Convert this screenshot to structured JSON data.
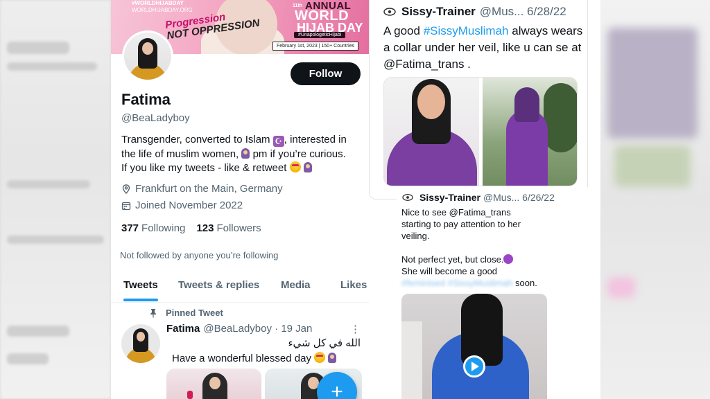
{
  "banner": {
    "tagline_1": "#WORLDHIJABDAY",
    "tagline_2": "WORLDHIJABDAY.ORG",
    "slogan_1": "Progression",
    "slogan_2": "NOT OPPRESSION",
    "event_small": "11th",
    "event_word_1": "ANNUAL",
    "event_word_2": "WORLD",
    "event_word_3": "HIJAB DAY",
    "hashtag": "#UnapologeticHijabi",
    "date": "February 1st, 2023 | 150+ Countries"
  },
  "profile": {
    "follow_label": "Follow",
    "display_name": "Fatima",
    "handle": "@BeaLadyboy",
    "bio_line_1": "Transgender, converted to Islam",
    "bio_line_1_end": ", interested in",
    "bio_line_2": "the life of muslim women,",
    "bio_line_2_end": "pm if you’re curious.",
    "bio_line_3": "If you like my tweets - like & retweet",
    "location": "Frankfurt on the Main, Germany",
    "joined": "Joined November 2022",
    "following_count": "377",
    "following_label": "Following",
    "followers_count": "123",
    "followers_label": "Followers",
    "not_followed": "Not followed by anyone you’re following"
  },
  "tabs": [
    "Tweets",
    "Tweets & replies",
    "Media",
    "Likes"
  ],
  "pinned": {
    "label": "Pinned Tweet",
    "name": "Fatima",
    "handle_date": "@BeaLadyboy · 19 Jan",
    "more": "⋮",
    "arabic": "الله في كل شيء",
    "text": "Have a wonderful blessed day"
  },
  "fab_label": "+",
  "tweet1": {
    "name": "Sissy-Trainer",
    "handle_date": "@Mus... 6/28/22",
    "text_1": "A good",
    "hashtag": "#SissyMuslimah",
    "text_2": "always wears a collar under her veil, like u can se at @Fatima_trans ."
  },
  "tweet2": {
    "name": "Sissy-Trainer",
    "handle_date": "@Mus... 6/26/22",
    "para_1": "Nice to see @Fatima_trans starting to pay attention to her veiling.",
    "para_2a": "Not perfect yet, but close.",
    "para_2b": "She will become a good",
    "blurred": "#feminised #SissyMuslimah",
    "para_2c": "soon."
  },
  "icons": {
    "location": "location-pin-icon",
    "calendar": "calendar-icon",
    "pin": "pin-icon",
    "play": "play-icon",
    "plus": "plus-icon"
  },
  "colors": {
    "accent": "#1d9bf0",
    "text": "#0f1419",
    "secondary": "#536471",
    "follow_bg": "#0f1419"
  }
}
